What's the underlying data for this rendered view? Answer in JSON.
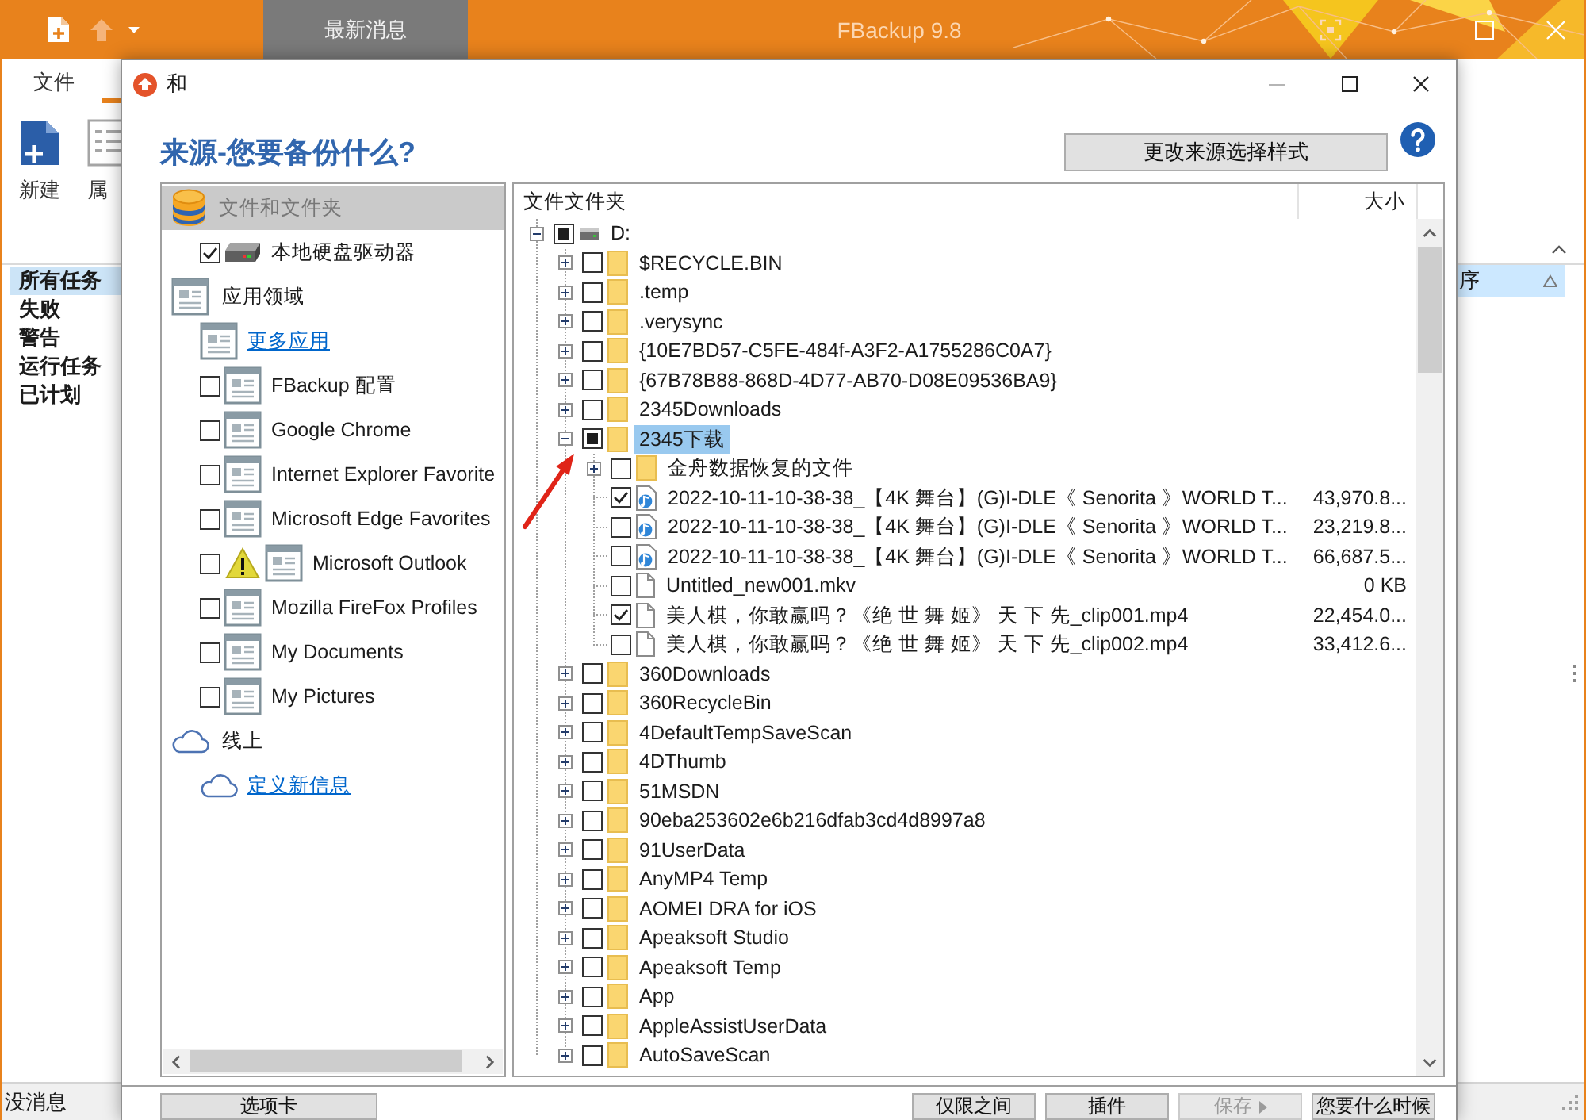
{
  "app": {
    "news_tab": "最新消息",
    "title": "FBackup 9.8",
    "ribbon_tab": "文件",
    "ribbon_buttons": [
      {
        "label": "新建"
      },
      {
        "label": "属"
      }
    ],
    "task_filters": [
      {
        "label": "所有任务",
        "selected": true
      },
      {
        "label": "失败",
        "selected": false
      },
      {
        "label": "警告",
        "selected": false
      },
      {
        "label": "运行任务",
        "selected": false
      },
      {
        "label": "已计划",
        "selected": false
      }
    ],
    "list_column": "序",
    "status_bar": "没消息"
  },
  "dialog": {
    "title": "和",
    "heading": "来源-您要备份什么?",
    "change_style_button": "更改来源选择样式",
    "sources": [
      {
        "kind": "files",
        "title": "文件和文件夹",
        "selected": true,
        "items": [
          {
            "kind": "checkbox",
            "label": "本地硬盘驱动器",
            "checked": true,
            "warning": false
          }
        ]
      },
      {
        "kind": "apps",
        "title": "应用领域",
        "selected": false,
        "items": [
          {
            "kind": "link",
            "label": "更多应用"
          },
          {
            "kind": "checkbox",
            "label": "FBackup 配置",
            "checked": false,
            "warning": false
          },
          {
            "kind": "checkbox",
            "label": "Google Chrome",
            "checked": false,
            "warning": false
          },
          {
            "kind": "checkbox",
            "label": "Internet Explorer Favorite",
            "checked": false,
            "warning": false
          },
          {
            "kind": "checkbox",
            "label": "Microsoft Edge Favorites",
            "checked": false,
            "warning": false
          },
          {
            "kind": "checkbox",
            "label": "Microsoft Outlook",
            "checked": false,
            "warning": true
          },
          {
            "kind": "checkbox",
            "label": "Mozilla FireFox Profiles",
            "checked": false,
            "warning": false
          },
          {
            "kind": "checkbox",
            "label": "My Documents",
            "checked": false,
            "warning": false
          },
          {
            "kind": "checkbox",
            "label": "My Pictures",
            "checked": false,
            "warning": false
          }
        ]
      },
      {
        "kind": "online",
        "title": "线上",
        "selected": false,
        "items": [
          {
            "kind": "link",
            "label": "定义新信息"
          }
        ]
      }
    ],
    "tree": {
      "columns": [
        {
          "label": "文件文件夹"
        },
        {
          "label": "大小"
        }
      ],
      "items": [
        {
          "kind": "drive",
          "name": "D:",
          "checked": false,
          "partial": true,
          "expanded": true,
          "selected": false,
          "children": [
            {
              "kind": "folder",
              "name": "$RECYCLE.BIN",
              "checked": false,
              "partial": false,
              "expanded": false,
              "selected": false
            },
            {
              "kind": "folder",
              "name": ".temp",
              "checked": false,
              "partial": false,
              "expanded": false,
              "selected": false
            },
            {
              "kind": "folder",
              "name": ".verysync",
              "checked": false,
              "partial": false,
              "expanded": false,
              "selected": false
            },
            {
              "kind": "folder",
              "name": "{10E7BD57-C5FE-484f-A3F2-A1755286C0A7}",
              "checked": false,
              "partial": false,
              "expanded": false,
              "selected": false
            },
            {
              "kind": "folder",
              "name": "{67B78B88-868D-4D77-AB70-D08E09536BA9}",
              "checked": false,
              "partial": false,
              "expanded": false,
              "selected": false
            },
            {
              "kind": "folder",
              "name": "2345Downloads",
              "checked": false,
              "partial": false,
              "expanded": false,
              "selected": false
            },
            {
              "kind": "folder",
              "name": "2345下载",
              "checked": false,
              "partial": true,
              "expanded": true,
              "selected": true,
              "children": [
                {
                  "kind": "folder",
                  "name": "金舟数据恢复的文件",
                  "checked": false,
                  "partial": false,
                  "expanded": false,
                  "selected": false
                },
                {
                  "kind": "media-file",
                  "name": "2022-10-11-10-38-38_【4K 舞台】(G)I-DLE《 Senorita 》WORLD T...",
                  "size": "43,970.8...",
                  "checked": true,
                  "partial": false,
                  "selected": false
                },
                {
                  "kind": "media-file",
                  "name": "2022-10-11-10-38-38_【4K 舞台】(G)I-DLE《 Senorita 》WORLD T...",
                  "size": "23,219.8...",
                  "checked": false,
                  "partial": false,
                  "selected": false
                },
                {
                  "kind": "media-file",
                  "name": "2022-10-11-10-38-38_【4K 舞台】(G)I-DLE《 Senorita 》WORLD T...",
                  "size": "66,687.5...",
                  "checked": false,
                  "partial": false,
                  "selected": false
                },
                {
                  "kind": "file",
                  "name": "Untitled_new001.mkv",
                  "size": "0 KB",
                  "checked": false,
                  "partial": false,
                  "selected": false
                },
                {
                  "kind": "file",
                  "name": "美人棋，你敢赢吗？《绝 世 舞 姬》 天 下 先_clip001.mp4",
                  "size": "22,454.0...",
                  "checked": true,
                  "partial": false,
                  "selected": false
                },
                {
                  "kind": "file",
                  "name": "美人棋，你敢赢吗？《绝 世 舞 姬》 天 下 先_clip002.mp4",
                  "size": "33,412.6...",
                  "checked": false,
                  "partial": false,
                  "selected": false
                }
              ]
            },
            {
              "kind": "folder",
              "name": "360Downloads",
              "checked": false,
              "partial": false,
              "expanded": false,
              "selected": false
            },
            {
              "kind": "folder",
              "name": "360RecycleBin",
              "checked": false,
              "partial": false,
              "expanded": false,
              "selected": false
            },
            {
              "kind": "folder",
              "name": "4DefaultTempSaveScan",
              "checked": false,
              "partial": false,
              "expanded": false,
              "selected": false
            },
            {
              "kind": "folder",
              "name": "4DThumb",
              "checked": false,
              "partial": false,
              "expanded": false,
              "selected": false
            },
            {
              "kind": "folder",
              "name": "51MSDN",
              "checked": false,
              "partial": false,
              "expanded": false,
              "selected": false
            },
            {
              "kind": "folder",
              "name": "90eba253602e6b216dfab3cd4d8997a8",
              "checked": false,
              "partial": false,
              "expanded": false,
              "selected": false
            },
            {
              "kind": "folder",
              "name": "91UserData",
              "checked": false,
              "partial": false,
              "expanded": false,
              "selected": false
            },
            {
              "kind": "folder",
              "name": "AnyMP4 Temp",
              "checked": false,
              "partial": false,
              "expanded": false,
              "selected": false
            },
            {
              "kind": "folder",
              "name": "AOMEI DRA for iOS",
              "checked": false,
              "partial": false,
              "expanded": false,
              "selected": false
            },
            {
              "kind": "folder",
              "name": "Apeaksoft Studio",
              "checked": false,
              "partial": false,
              "expanded": false,
              "selected": false
            },
            {
              "kind": "folder",
              "name": "Apeaksoft Temp",
              "checked": false,
              "partial": false,
              "expanded": false,
              "selected": false
            },
            {
              "kind": "folder",
              "name": "App",
              "checked": false,
              "partial": false,
              "expanded": false,
              "selected": false
            },
            {
              "kind": "folder",
              "name": "AppleAssistUserData",
              "checked": false,
              "partial": false,
              "expanded": false,
              "selected": false
            },
            {
              "kind": "folder",
              "name": "AutoSaveScan",
              "checked": false,
              "partial": false,
              "expanded": false,
              "selected": false
            }
          ]
        }
      ]
    },
    "buttons": [
      {
        "label": "选项卡",
        "disabled": false,
        "arrow": false
      },
      {
        "label": "仅限之间",
        "disabled": false,
        "arrow": false
      },
      {
        "label": "插件",
        "disabled": false,
        "arrow": false
      },
      {
        "label": "保存",
        "disabled": true,
        "arrow": true
      },
      {
        "label": "您要什么时候",
        "disabled": false,
        "arrow": false
      }
    ]
  }
}
